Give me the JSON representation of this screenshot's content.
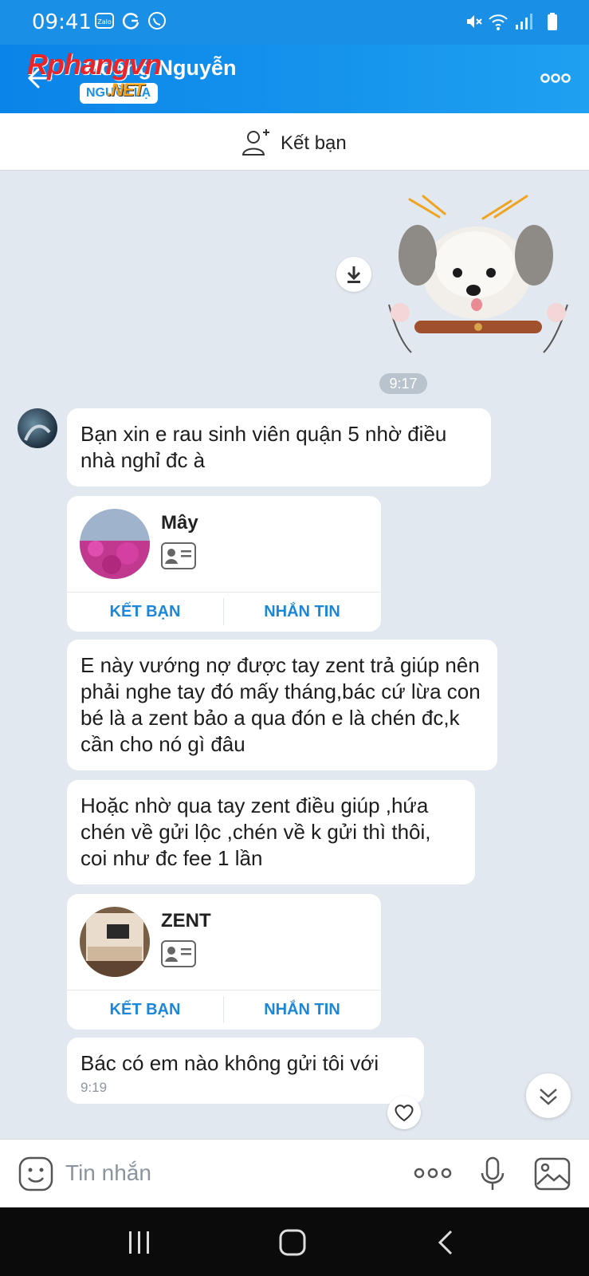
{
  "status_bar": {
    "time": "09:41"
  },
  "header": {
    "title": "Hoàng Nguyễn",
    "subtitle": "NGƯỜI LẠ",
    "watermark": "Rphangvn",
    "watermark_suffix": ".NET"
  },
  "friend_bar": {
    "label": "Kết bạn"
  },
  "sticker_time": "9:17",
  "messages": {
    "m1": "Bạn xin e rau sinh viên quận 5 nhờ điều nhà nghỉ đc à",
    "m2": "E này vướng nợ được tay zent trả giúp nên phải nghe tay đó mấy tháng,bác cứ lừa con bé là a zent bảo a qua đón e là chén đc,k cần cho nó gì đâu",
    "m3": "Hoặc nhờ qua tay zent điều giúp ,hứa chén về gửi lộc ,chén về k gửi thì thôi, coi như đc fee 1 lần",
    "m4": "Bác có em nào không gửi tôi với",
    "m4_time": "9:19"
  },
  "cards": [
    {
      "name": "Mây",
      "add_label": "KẾT BẠN",
      "msg_label": "NHẮN TIN"
    },
    {
      "name": "ZENT",
      "add_label": "KẾT BẠN",
      "msg_label": "NHẮN TIN"
    }
  ],
  "composer": {
    "placeholder": "Tin nhắn"
  },
  "colors": {
    "accent": "#1a8fe6",
    "link": "#1b87d8",
    "background": "#e2e8ef"
  },
  "icons": [
    "back-arrow-icon",
    "more-icon",
    "add-friend-icon",
    "download-icon",
    "contact-card-icon",
    "heart-icon",
    "double-chevron-down-icon",
    "emoji-icon",
    "microphone-icon",
    "gallery-icon"
  ]
}
